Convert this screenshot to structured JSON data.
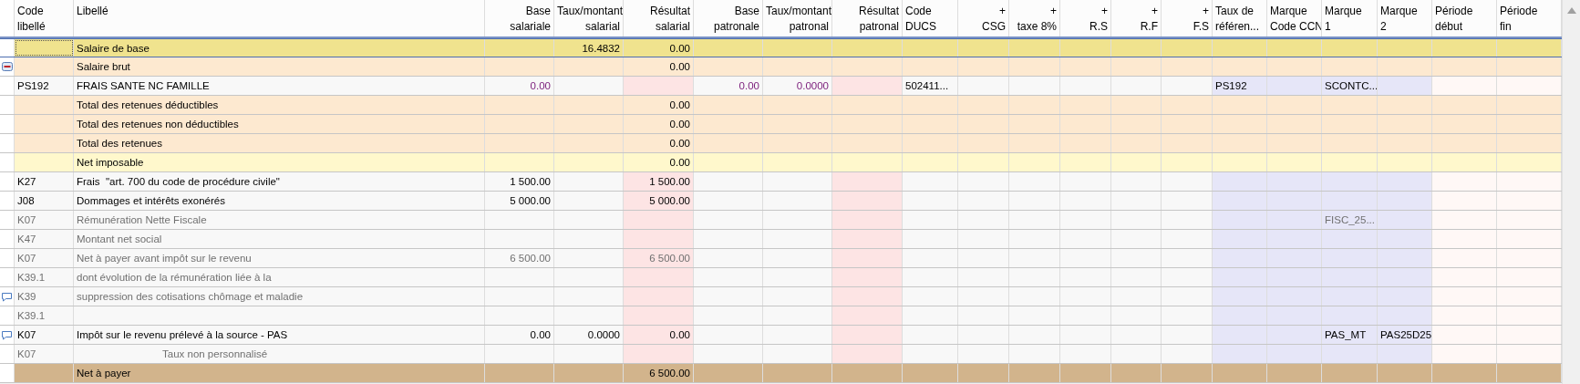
{
  "table": {
    "columns": [
      {
        "lines": [
          "Code",
          "libellé"
        ]
      },
      {
        "lines": [
          "Libellé"
        ]
      },
      {
        "lines": [
          "Base",
          "salariale"
        ]
      },
      {
        "lines": [
          "Taux/montant",
          "salarial"
        ]
      },
      {
        "lines": [
          "Résultat",
          "salarial"
        ]
      },
      {
        "lines": [
          "Base",
          "patronale"
        ]
      },
      {
        "lines": [
          "Taux/montant",
          "patronal"
        ]
      },
      {
        "lines": [
          "Résultat",
          "patronal"
        ]
      },
      {
        "lines": [
          "Code",
          "DUCS"
        ]
      },
      {
        "lines": [
          "+",
          "CSG"
        ]
      },
      {
        "lines": [
          "+",
          "taxe 8%"
        ]
      },
      {
        "lines": [
          "+",
          "R.S"
        ]
      },
      {
        "lines": [
          "+",
          "R.F"
        ]
      },
      {
        "lines": [
          "+",
          "F.S"
        ]
      },
      {
        "lines": [
          "Taux de",
          "référen..."
        ]
      },
      {
        "lines": [
          "Marque",
          "Code CCN"
        ]
      },
      {
        "lines": [
          "Marque",
          "1"
        ]
      },
      {
        "lines": [
          "Marque",
          "2"
        ]
      },
      {
        "lines": [
          "Période",
          "début"
        ]
      },
      {
        "lines": [
          "Période",
          "fin"
        ]
      }
    ],
    "rows": [
      {
        "kind": "base",
        "selected": true,
        "muted": false,
        "libelle": "Salaire de base",
        "taux_salarial": "16.4832",
        "resultat_salarial": "0.00"
      },
      {
        "kind": "total",
        "selected": false,
        "muted": false,
        "expanded": true,
        "libelle": "Salaire brut",
        "resultat_salarial": "0.00"
      },
      {
        "kind": "input",
        "selected": false,
        "muted": false,
        "code": "PS192",
        "libelle": "FRAIS SANTE NC FAMILLE",
        "base_salariale": "0.00",
        "base_patronale": "0.00",
        "taux_patronal": "0.0000",
        "code_ducs": "502411...",
        "taux_reference": "PS192",
        "marque_1": "SCONTC..."
      },
      {
        "kind": "total",
        "selected": false,
        "muted": false,
        "libelle": "Total des retenues déductibles",
        "resultat_salarial": "0.00"
      },
      {
        "kind": "total",
        "selected": false,
        "muted": false,
        "libelle": "Total des retenues non déductibles",
        "resultat_salarial": "0.00"
      },
      {
        "kind": "total",
        "selected": false,
        "muted": false,
        "libelle": "Total des retenues",
        "resultat_salarial": "0.00"
      },
      {
        "kind": "taxable",
        "selected": false,
        "muted": false,
        "libelle": "Net imposable",
        "resultat_salarial": "0.00"
      },
      {
        "kind": "line",
        "selected": false,
        "muted": false,
        "code": "K27",
        "libelle": "Frais  \"art. 700 du code de procédure civile\"",
        "base_salariale": "1 500.00",
        "resultat_salarial": "1 500.00"
      },
      {
        "kind": "line",
        "selected": false,
        "muted": false,
        "code": "J08",
        "libelle": "Dommages et intérêts exonérés",
        "base_salariale": "5 000.00",
        "resultat_salarial": "5 000.00"
      },
      {
        "kind": "line",
        "selected": false,
        "muted": true,
        "code": "K07",
        "libelle": "Rémunération Nette Fiscale",
        "marque_1": "FISC_25..."
      },
      {
        "kind": "line",
        "selected": false,
        "muted": true,
        "code": "K47",
        "libelle": "Montant net social"
      },
      {
        "kind": "line",
        "selected": false,
        "muted": true,
        "code": "K07",
        "libelle": "Net à payer avant impôt sur le revenu",
        "base_salariale": "6 500.00",
        "resultat_salarial": "6 500.00"
      },
      {
        "kind": "line",
        "selected": false,
        "muted": true,
        "code": "K39.1",
        "libelle": "dont évolution de la rémunération liée à la"
      },
      {
        "kind": "line",
        "selected": false,
        "muted": true,
        "commented": true,
        "code": "K39",
        "libelle": "suppression des cotisations chômage et maladie"
      },
      {
        "kind": "line",
        "selected": false,
        "muted": true,
        "code": "K39.1"
      },
      {
        "kind": "line",
        "selected": false,
        "muted": false,
        "commented": true,
        "code": "K07",
        "libelle": "Impôt sur le revenu prélevé à la source - PAS",
        "base_salariale": "0.00",
        "taux_salarial": "0.0000",
        "resultat_salarial": "0.00",
        "marque_1": "PAS_MT",
        "marque_2": "PAS25D25"
      },
      {
        "kind": "line",
        "selected": false,
        "muted": true,
        "indented": true,
        "code": "K07",
        "libelle": "Taux non personnalisé"
      },
      {
        "kind": "net",
        "selected": false,
        "muted": false,
        "libelle": "Net à payer",
        "resultat_salarial": "6 500.00"
      }
    ]
  }
}
